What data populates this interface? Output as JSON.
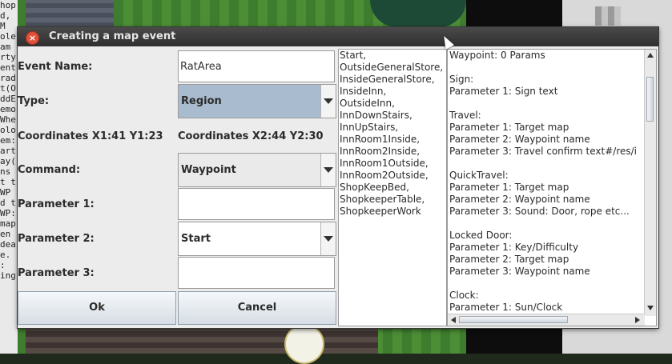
{
  "background": {
    "terminal_lines": [
      "hop",
      "d,",
      "M",
      "ole",
      "am",
      "rty",
      "ent",
      "rad",
      "t(O",
      "ddE",
      "emo",
      "Whe",
      "olo",
      "em:",
      "art",
      "ay(",
      "ns",
      "t t",
      "WP",
      "d t",
      "WP:",
      "map",
      "",
      "en",
      "dea",
      "e.",
      ":",
      "ing"
    ]
  },
  "dialog": {
    "title": "Creating a map event",
    "close_icon": "close-icon"
  },
  "form": {
    "event_name_label": "Event Name:",
    "event_name_value": "RatArea",
    "type_label": "Type:",
    "type_value": "Region",
    "coord1": "Coordinates X1:41 Y1:23",
    "coord2": "Coordinates X2:44 Y2:30",
    "command_label": "Command:",
    "command_value": "Waypoint",
    "param1_label": "Parameter 1:",
    "param1_value": "",
    "param2_label": "Parameter 2:",
    "param2_value": "Start",
    "param3_label": "Parameter 3:",
    "param3_value": "",
    "ok_label": "Ok",
    "cancel_label": "Cancel"
  },
  "waypoint_list": [
    "Start,",
    "OutsideGeneralStore,",
    "InsideGeneralStore,",
    "InsideInn,",
    "OutsideInn,",
    "InnDownStairs,",
    "InnUpStairs,",
    "InnRoom1Inside,",
    "InnRoom2Inside,",
    "InnRoom1Outside,",
    "InnRoom2Outside,",
    "ShopKeepBed,",
    "ShopkeeperTable,",
    "ShopkeeperWork"
  ],
  "help_lines": [
    "Waypoint: 0 Params",
    "",
    "Sign:",
    "Parameter 1: Sign text",
    "",
    "Travel:",
    "Parameter 1: Target map",
    "Parameter 2: Waypoint name",
    "Parameter 3: Travel confirm text#/res/i",
    "",
    "QuickTravel:",
    "Parameter 1: Target map",
    "Parameter 2: Waypoint name",
    "Parameter 3: Sound: Door, rope etc...",
    "",
    "Locked Door:",
    "Parameter 1: Key/Difficulty",
    "Parameter 2: Target map",
    "Parameter 3: Waypoint name",
    "",
    "Clock:",
    "Parameter 1: Sun/Clock"
  ],
  "colors": {
    "selected_combo": "#a9bccf",
    "titlebar": "#3a3a3a",
    "close": "#e0513a"
  }
}
